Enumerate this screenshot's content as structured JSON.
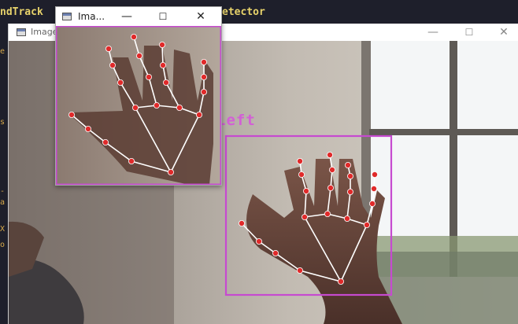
{
  "ide": {
    "code_left": "ndTrack",
    "code_right": "etector",
    "gutter_marks": [
      "e",
      "s",
      "-",
      "a",
      "X",
      "o"
    ]
  },
  "main_window": {
    "title": "Image",
    "minimize_glyph": "—",
    "maximize_glyph": "☐",
    "close_glyph": "✕",
    "hand_label": "Left"
  },
  "small_window": {
    "title": "Ima...",
    "minimize_glyph": "—",
    "maximize_glyph": "☐",
    "close_glyph": "✕"
  },
  "colors": {
    "bbox": "#c64ad0",
    "landmark": "#e02a2a",
    "connection": "#ffffff",
    "label": "#d35fd6"
  }
}
